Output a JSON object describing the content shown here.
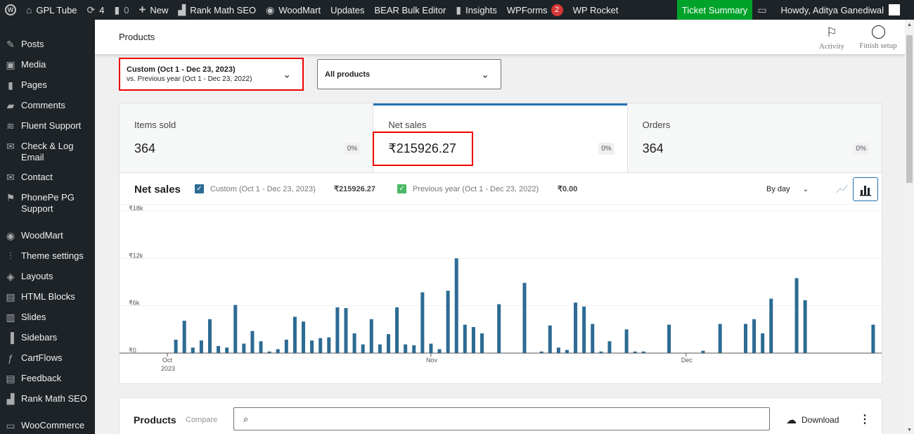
{
  "adminbar": {
    "site_name": "GPL Tube",
    "updates_count": "4",
    "comments_count": "0",
    "new_label": "New",
    "items": [
      "Rank Math SEO",
      "WoodMart",
      "Updates",
      "BEAR Bulk Editor",
      "Insights",
      "WPForms",
      "WP Rocket"
    ],
    "wpforms_badge": "2",
    "ticket_label": "Ticket Summary",
    "howdy": "Howdy, Aditya Ganediwal"
  },
  "sidebar": {
    "items": [
      {
        "label": "Posts",
        "icon": "pushpin-icon"
      },
      {
        "label": "Media",
        "icon": "media-icon"
      },
      {
        "label": "Pages",
        "icon": "pages-icon"
      },
      {
        "label": "Comments",
        "icon": "comment-icon"
      },
      {
        "label": "Fluent Support",
        "icon": "fluent-icon"
      },
      {
        "label": "Check & Log Email",
        "icon": "email-icon"
      },
      {
        "label": "Contact",
        "icon": "email-icon"
      },
      {
        "label": "PhonePe PG Support",
        "icon": "plugin-icon"
      },
      {
        "label": "WoodMart",
        "icon": "woodmart-icon"
      },
      {
        "label": "Theme settings",
        "icon": "settings-icon"
      },
      {
        "label": "Layouts",
        "icon": "layers-icon"
      },
      {
        "label": "HTML Blocks",
        "icon": "html-icon"
      },
      {
        "label": "Slides",
        "icon": "slides-icon"
      },
      {
        "label": "Sidebars",
        "icon": "sidebars-icon"
      },
      {
        "label": "CartFlows",
        "icon": "cartflows-icon"
      },
      {
        "label": "Feedback",
        "icon": "feedback-icon"
      },
      {
        "label": "Rank Math SEO",
        "icon": "rankmath-icon"
      },
      {
        "label": "WooCommerce",
        "icon": "woo-icon"
      }
    ]
  },
  "header": {
    "title": "Products",
    "activity": "Activity",
    "finish_setup": "Finish setup"
  },
  "date_filter": {
    "line1": "Custom (Oct 1 - Dec 23, 2023)",
    "line2": "vs. Previous year (Oct 1 - Dec 23, 2022)"
  },
  "product_filter": {
    "value": "All products"
  },
  "perf": [
    {
      "label": "Items sold",
      "value": "364",
      "delta": "0%",
      "selected": false
    },
    {
      "label": "Net sales",
      "value": "₹215926.27",
      "delta": "0%",
      "selected": true
    },
    {
      "label": "Orders",
      "value": "364",
      "delta": "0%",
      "selected": false
    }
  ],
  "chart_header": {
    "title": "Net sales",
    "legend": [
      {
        "label": "Custom (Oct 1 - Dec 23, 2023)",
        "amount": "₹215926.27",
        "color": "#2c6b94"
      },
      {
        "label": "Previous year (Oct 1 - Dec 23, 2022)",
        "amount": "₹0.00",
        "color": "#4ab866"
      }
    ],
    "interval": "By day"
  },
  "chart_data": {
    "type": "bar",
    "yticks": [
      "₹18k",
      "₹12k",
      "₹6k",
      "₹0"
    ],
    "ylim": [
      0,
      18000
    ],
    "xticks": [
      {
        "label": "Oct",
        "sub": "2023",
        "day": 1
      },
      {
        "label": "Nov",
        "sub": "",
        "day": 32
      },
      {
        "label": "Dec",
        "sub": "",
        "day": 62
      }
    ],
    "series": [
      {
        "name": "Custom (Oct 1 - Dec 23, 2023)",
        "color": "#2c6b94",
        "values": [
          0,
          1700,
          4100,
          700,
          1600,
          4300,
          900,
          700,
          6100,
          1200,
          2800,
          1500,
          200,
          500,
          1700,
          4600,
          4000,
          1600,
          1900,
          2000,
          5800,
          5700,
          2500,
          1100,
          4300,
          1100,
          2400,
          5800,
          1100,
          1000,
          7700,
          1200,
          500,
          7900,
          12000,
          3600,
          3300,
          2500,
          0,
          6200,
          0,
          0,
          8900,
          0,
          200,
          3500,
          700,
          400,
          6400,
          5900,
          3700,
          200,
          1500,
          0,
          3000,
          200,
          200,
          0,
          0,
          3600,
          0,
          0,
          0,
          300,
          0,
          3700,
          0,
          0,
          3700,
          4300,
          2500,
          6900,
          0,
          0,
          9500,
          6700,
          0,
          0,
          0,
          0,
          0,
          0,
          0,
          3600
        ]
      }
    ]
  },
  "products": {
    "title": "Products",
    "compare": "Compare",
    "download": "Download"
  }
}
